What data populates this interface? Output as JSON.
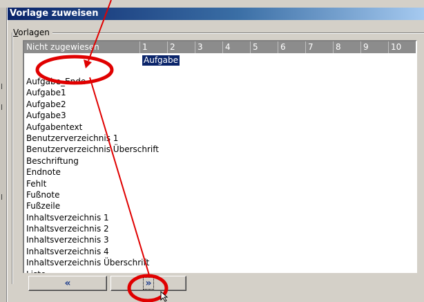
{
  "dialog": {
    "title": "Vorlage zuweisen",
    "group_label": "Vorlagen",
    "group_label_mnemonic": "V",
    "group_label_rest": "orlagen"
  },
  "grid": {
    "columns": [
      "Nicht zugewiesen",
      "1",
      "2",
      "3",
      "4",
      "5",
      "6",
      "7",
      "8",
      "9",
      "10"
    ],
    "assigned_item": "Aufgabe",
    "rows": [
      "Aufgabe_Ende",
      "Aufgabe1",
      "Aufgabe2",
      "Aufgabe3",
      "Aufgabentext",
      "Benutzerverzeichnis 1",
      "Benutzerverzeichnis Überschrift",
      "Beschriftung",
      "Endnote",
      "Fehlt",
      "Fußnote",
      "Fußzeile",
      "Inhaltsverzeichnis 1",
      "Inhaltsverzeichnis 2",
      "Inhaltsverzeichnis 3",
      "Inhaltsverzeichnis 4",
      "Inhaltsverzeichnis Überschrift",
      "Liste"
    ]
  },
  "buttons": {
    "prev_label": "«",
    "next_label": "»"
  },
  "colors": {
    "titlebar": "#0a246a",
    "annotation": "#e00000",
    "selection": "#0a246a"
  }
}
